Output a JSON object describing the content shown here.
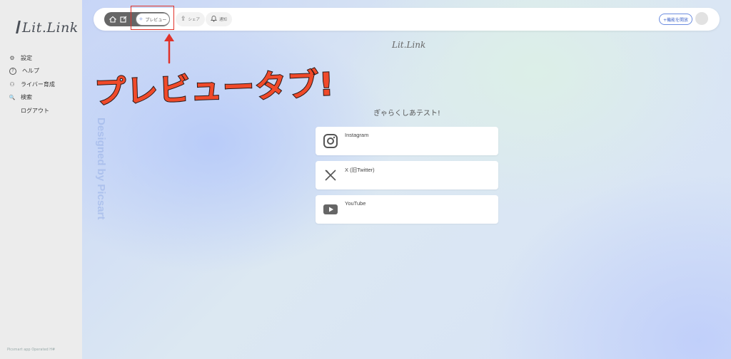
{
  "sidebar": {
    "logo": "Lit.Link",
    "items": [
      {
        "icon": "gear-icon",
        "glyph": "⚙",
        "label": "設定"
      },
      {
        "icon": "help-icon",
        "glyph": "?",
        "label": "ヘルプ"
      },
      {
        "icon": "people-icon",
        "glyph": "⚇",
        "label": "ライバー育成"
      },
      {
        "icon": "search-icon",
        "glyph": "🔍",
        "label": "検索"
      },
      {
        "icon": "",
        "glyph": "",
        "label": "ログアウト"
      }
    ],
    "footer": "Picsmart app Operated H#"
  },
  "topbar": {
    "preview_label": "プレビュー",
    "share_label": "シェア",
    "notify_label": "通知",
    "publish_label": "+機能を開放"
  },
  "watermark": "Designed by Picsart",
  "annotation": {
    "callout": "プレビュータブ!",
    "color": "#e0322a"
  },
  "profile": {
    "logo": "Lit.Link",
    "name": "ぎゃらくしあテスト!",
    "links": [
      {
        "title": "Instagram",
        "icon": "instagram-icon"
      },
      {
        "title": "X (旧Twitter)",
        "icon": "x-icon"
      },
      {
        "title": "YouTube",
        "icon": "youtube-icon"
      }
    ]
  }
}
